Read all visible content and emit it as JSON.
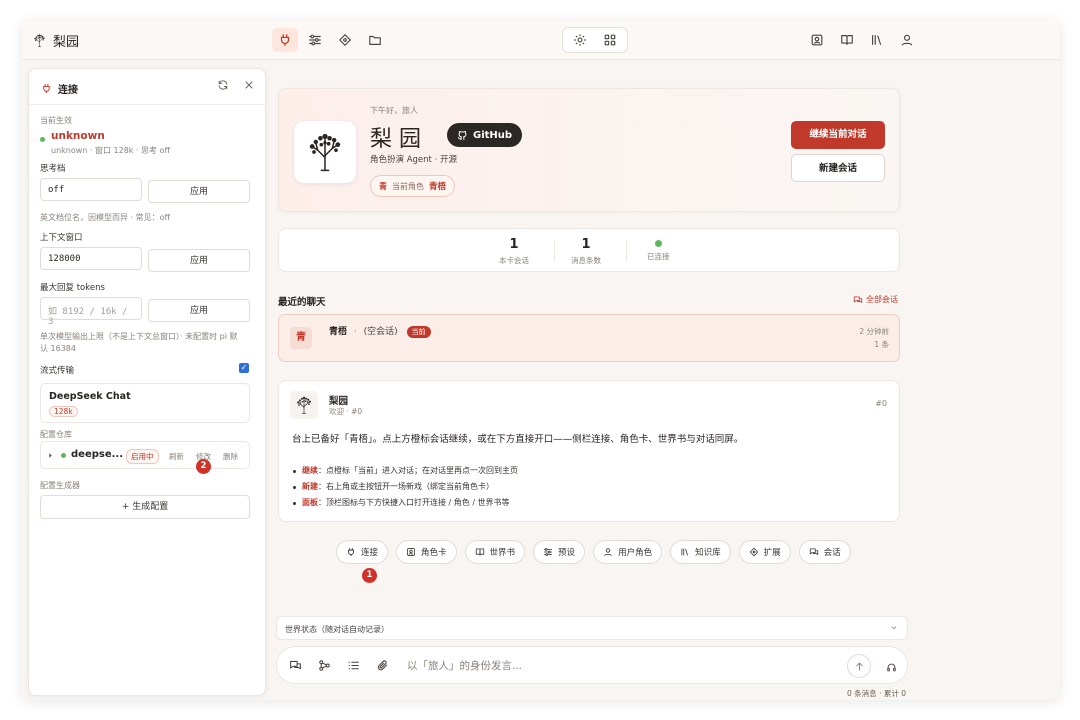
{
  "app": {
    "title": "梨园"
  },
  "colors": {
    "accent": "#c0392b",
    "status_green": "#5cb85c"
  },
  "topbar_icons": [
    "plug-icon",
    "sliders-icon",
    "puzzle-icon",
    "folder-icon",
    "gear-icon",
    "grid-icon",
    "id-card-icon",
    "book-icon",
    "library-icon",
    "user-icon"
  ],
  "sidebar": {
    "title": "连接",
    "current_label": "当前生效",
    "current_model": "unknown",
    "current_meta": "unknown · 窗口 128k · 思考 off",
    "think": {
      "label": "思考档",
      "value": "off",
      "apply": "应用",
      "hint": "英文档位名，因模型而异 · 常见：off"
    },
    "context": {
      "label": "上下文窗口",
      "value": "128000",
      "apply": "应用"
    },
    "max_tokens": {
      "label": "最大回复 tokens",
      "placeholder": "如 8192 / 16k / 3",
      "apply": "应用",
      "hint_1": "单次模型输出上限（不是上下文总窗口）· 未配置时 pi 默",
      "hint_2": "认 16384"
    },
    "stream": {
      "label": "流式传输",
      "checked": true
    },
    "model_card": {
      "name": "DeepSeek Chat",
      "badge": "128k"
    },
    "repo": {
      "label": "配置仓库",
      "name": "deepse...",
      "status": "启用中",
      "refresh": "刷新",
      "edit": "修改",
      "delete": "删除"
    },
    "generator": {
      "label": "配置生成器",
      "button": "+ 生成配置"
    }
  },
  "hero": {
    "greeting": "下午好，旅人",
    "title": "梨 园",
    "github": "GitHub",
    "subtitle": "角色扮演 Agent · 开源",
    "role_badge": "青",
    "role_label": "当前角色",
    "role_name": "青梧",
    "continue_button": "继续当前对话",
    "new_button": "新建会话"
  },
  "stats": [
    {
      "value": "1",
      "label": "本卡会话"
    },
    {
      "value": "1",
      "label": "消息条数"
    },
    {
      "value": "",
      "label": "已连接"
    }
  ],
  "recent": {
    "title": "最近的聊天",
    "all_link": "全部会话",
    "item": {
      "avatar": "青",
      "name": "青梧",
      "sep": "·",
      "desc": "(空会话)",
      "badge": "当前",
      "time": "2 分钟前",
      "count": "1 条"
    }
  },
  "message": {
    "author": "梨园",
    "sub": "欢迎 · #0",
    "index": "#0",
    "text": "台上已备好「青梧」。点上方橙标会话继续，或在下方直接开口——侧栏连接、角色卡、世界书与对话同屏。",
    "bullets": [
      {
        "key": "继续",
        "text": "：点橙标「当前」进入对话；在对话里再点一次回到主页"
      },
      {
        "key": "新建",
        "text": "：右上角或主按钮开一场新戏（绑定当前角色卡）"
      },
      {
        "key": "面板",
        "text": "：顶栏图标与下方快捷入口打开连接 / 角色 / 世界书等"
      }
    ]
  },
  "shortcuts": [
    "连接",
    "角色卡",
    "世界书",
    "预设",
    "用户角色",
    "知识库",
    "扩展",
    "会话"
  ],
  "markers": [
    "1",
    "2"
  ],
  "world_state": {
    "label": "世界状态（随对话自动记录）"
  },
  "composer": {
    "placeholder": "以「旅人」的身份发言...",
    "footer": "0 条消息 · 累计 0"
  }
}
